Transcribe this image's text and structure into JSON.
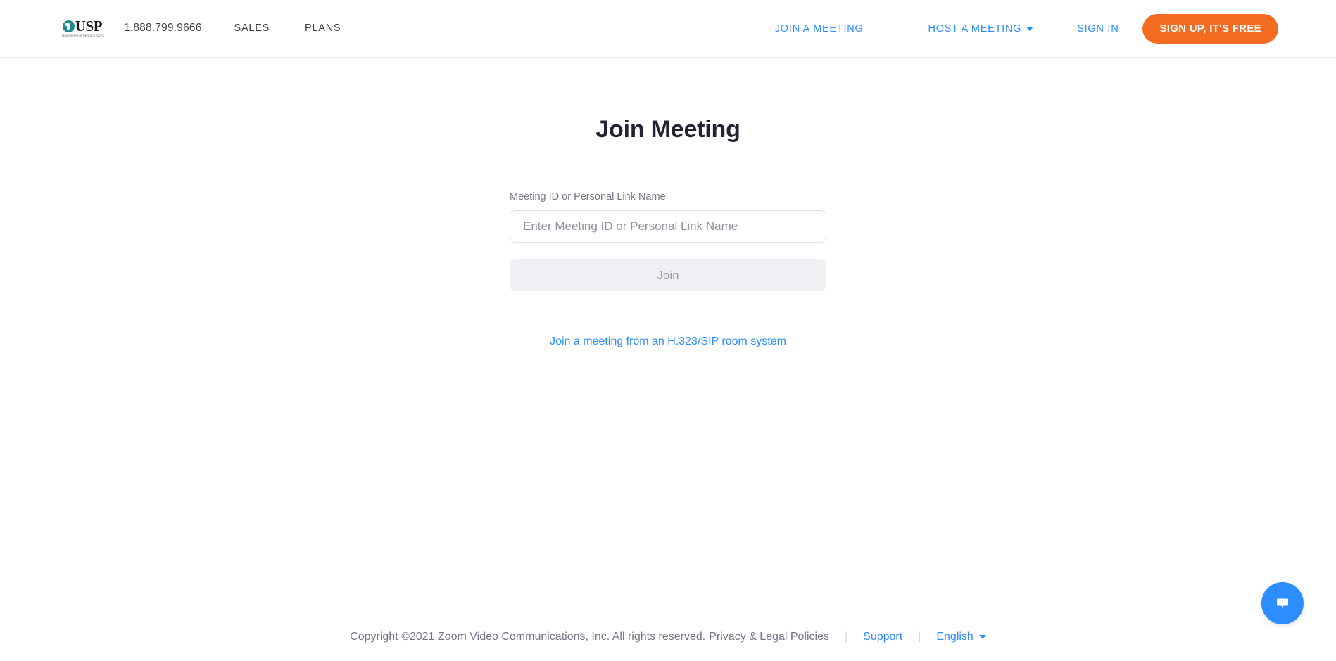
{
  "header": {
    "logo": {
      "wordmark": "USP",
      "subtitle": "THE UNIVERSITY OF THE SOUTH PACIFIC",
      "mark_color": "#1e8a8f"
    },
    "phone": "1.888.799.9666",
    "nav_left": [
      {
        "label": "SALES"
      },
      {
        "label": "PLANS"
      }
    ],
    "nav_right": {
      "join_a_meeting": "JOIN A MEETING",
      "host_a_meeting": "HOST A MEETING",
      "sign_in": "SIGN IN",
      "sign_up": "SIGN UP, IT'S FREE"
    },
    "accent_blue": "#2d8cff",
    "signup_orange": "#f26b21"
  },
  "main": {
    "title": "Join Meeting",
    "field_label": "Meeting ID or Personal Link Name",
    "input_placeholder": "Enter Meeting ID or Personal Link Name",
    "input_value": "",
    "join_button": "Join",
    "sip_link": "Join a meeting from an H.323/SIP room system"
  },
  "footer": {
    "copyright": "Copyright ©2021 Zoom Video Communications, Inc. All rights reserved.",
    "privacy": "Privacy & Legal Policies",
    "separator": "|",
    "support": "Support",
    "language": "English"
  },
  "chat": {
    "label": "chat-bubble-icon",
    "color": "#2d8cff"
  }
}
